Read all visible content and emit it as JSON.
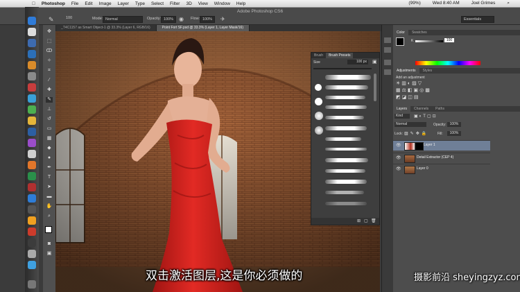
{
  "menubar": {
    "apple": "",
    "items": [
      "Photoshop",
      "File",
      "Edit",
      "Image",
      "Layer",
      "Type",
      "Select",
      "Filter",
      "3D",
      "View",
      "Window",
      "Help"
    ],
    "battery": "(99%)",
    "clock": "Wed 8:40 AM",
    "user": "Joel Grimes"
  },
  "options": {
    "window_title": "Adobe Photoshop CS6",
    "brush_size": "100",
    "mode_label": "Mode:",
    "mode_value": "Normal",
    "opacity_label": "Opacity:",
    "opacity_value": "100%",
    "flow_label": "Flow:",
    "flow_value": "100%",
    "workspace": "Essentials"
  },
  "doc_tabs": [
    "_T4C1157 as Smart Object-1 @ 33.3% (Layer 6, RGB/16)",
    "Point Fort SF.psd @ 33.3% (Layer 1, Layer Mask/16)"
  ],
  "brush_panel": {
    "tabs": [
      "Brush",
      "Brush Presets"
    ],
    "size_label": "Size",
    "size_value": "100 px"
  },
  "color_panel": {
    "tabs": [
      "Color",
      "Swatches"
    ],
    "k_label": "K",
    "k_value": "100"
  },
  "adjustments_panel": {
    "tabs": [
      "Adjustments",
      "Styles"
    ],
    "heading": "Add an adjustment"
  },
  "layers_panel": {
    "tabs": [
      "Layers",
      "Channels",
      "Paths"
    ],
    "kind_filter": "Kind",
    "blend_mode": "Normal",
    "opacity_label": "Opacity:",
    "opacity_value": "100%",
    "lock_label": "Lock:",
    "fill_label": "Fill:",
    "fill_value": "100%",
    "layers": [
      {
        "name": "Layer 1",
        "selected": true
      },
      {
        "name": "Detail Extractor (CEP 4)",
        "selected": false
      },
      {
        "name": "Layer 0",
        "selected": false
      }
    ]
  },
  "subtitle": "双击激活图层,这是你必须做的",
  "watermark": "摄影前沿 sheyingzyz.com",
  "colors": {
    "dress": "#d8221f",
    "layer_selected": "#6f7f97",
    "panel_bg": "#4d4d4d"
  }
}
